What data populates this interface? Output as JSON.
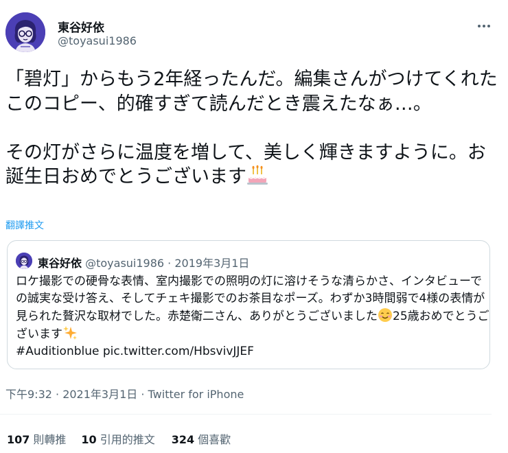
{
  "author": {
    "name": "東谷好依",
    "handle": "@toyasui1986"
  },
  "tweet": {
    "text": "「碧灯」からもう2年経ったんだ。編集さんがつけてくれたこのコピー、的確すぎて読んだとき震えたなぁ…。\n\nその灯がさらに温度を増して、美しく輝きますように。お誕生日おめでとうございます",
    "translate_label": "翻譯推文"
  },
  "quoted": {
    "name": "東谷好依",
    "handle_date": "@toyasui1986 · 2019年3月1日",
    "text_part1": "ロケ撮影での硬骨な表情、室内撮影での照明の灯に溶けそうな清らかさ、インタビューでの誠実な受け答え、そしてチェキ撮影でのお茶目なポーズ。わずか3時間弱で4様の表情が見られた贅沢な取材でした。赤楚衛二さん、ありがとうございました",
    "text_part2": "25歳おめでとうございます",
    "hashtag": "#Auditionblue",
    "link": "pic.twitter.com/HbsvivJJEF"
  },
  "meta": {
    "time_date": "下午9:32 · 2021年3月1日 · ",
    "source": "Twitter for iPhone"
  },
  "stats": {
    "retweets_count": "107",
    "retweets_label": "則轉推",
    "quotes_count": "10",
    "quotes_label": "引用的推文",
    "likes_count": "324",
    "likes_label": "個喜歡"
  },
  "icons": {
    "avatar": "illustrated-woman-avatar",
    "more": "more-horizontal-icon",
    "cake": "birthday-cake-emoji",
    "smile": "smiling-face-emoji",
    "sparkles": "sparkles-emoji"
  },
  "colors": {
    "link": "#1d9bf0",
    "secondary_text": "#536471",
    "avatar_bg": "#4b3fb5"
  }
}
